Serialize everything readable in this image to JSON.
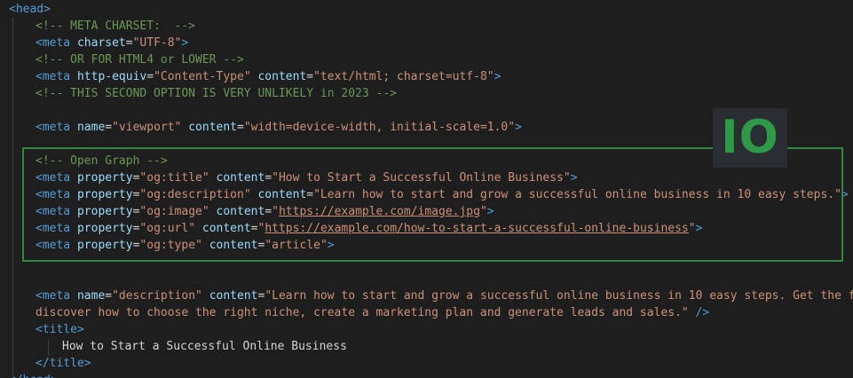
{
  "logo": {
    "text": "IO"
  },
  "lines": {
    "l0": {
      "open": "<",
      "tag": "head",
      "close": ">"
    },
    "l1": {
      "comment": "<!-- META CHARSET:  -->"
    },
    "l2": {
      "open": "<",
      "tag": "meta",
      "attr1": "charset",
      "eq1": "=",
      "val1": "\"UTF-8\"",
      "close": ">"
    },
    "l3": {
      "comment": "<!-- OR FOR HTML4 or LOWER -->"
    },
    "l4": {
      "open": "<",
      "tag": "meta",
      "attr1": "http-equiv",
      "eq1": "=",
      "val1": "\"Content-Type\"",
      "attr2": "content",
      "eq2": "=",
      "val2": "\"text/html; charset=utf-8\"",
      "close": ">"
    },
    "l5": {
      "comment": "<!-- THIS SECOND OPTION IS VERY UNLIKELY in 2023 -->"
    },
    "l7": {
      "open": "<",
      "tag": "meta",
      "attr1": "name",
      "eq1": "=",
      "val1": "\"viewport\"",
      "attr2": "content",
      "eq2": "=",
      "val2": "\"width=device-width, initial-scale=1.0\"",
      "close": ">"
    },
    "l9": {
      "comment": "<!-- Open Graph -->"
    },
    "l10": {
      "open": "<",
      "tag": "meta",
      "attr1": "property",
      "eq1": "=",
      "val1": "\"og:title\"",
      "attr2": "content",
      "eq2": "=",
      "val2": "\"How to Start a Successful Online Business\"",
      "close": ">"
    },
    "l11": {
      "open": "<",
      "tag": "meta",
      "attr1": "property",
      "eq1": "=",
      "val1": "\"og:description\"",
      "attr2": "content",
      "eq2": "=",
      "val2": "\"Learn how to start and grow a successful online business in 10 easy steps.\"",
      "close": ">"
    },
    "l12": {
      "open": "<",
      "tag": "meta",
      "attr1": "property",
      "eq1": "=",
      "val1": "\"og:image\"",
      "attr2": "content",
      "eq2": "=",
      "q_open": "\"",
      "url": "https://example.com/image.jpg",
      "q_close": "\"",
      "close": ">"
    },
    "l13": {
      "open": "<",
      "tag": "meta",
      "attr1": "property",
      "eq1": "=",
      "val1": "\"og:url\"",
      "attr2": "content",
      "eq2": "=",
      "q_open": "\"",
      "url": "https://example.com/how-to-start-a-successful-online-business",
      "q_close": "\"",
      "close": ">"
    },
    "l14": {
      "open": "<",
      "tag": "meta",
      "attr1": "property",
      "eq1": "=",
      "val1": "\"og:type\"",
      "attr2": "content",
      "eq2": "=",
      "val2": "\"article\"",
      "close": ">"
    },
    "l17": {
      "open": "<",
      "tag": "meta",
      "attr1": "name",
      "eq1": "=",
      "val1": "\"description\"",
      "attr2": "content",
      "eq2": "=",
      "val2": "\"Learn how to start and grow a successful online business in 10 easy steps. Get the fre"
    },
    "l18": {
      "val": "discover how to choose the right niche, create a marketing plan and generate leads and sales.\"",
      "close": " />"
    },
    "l19": {
      "open": "<",
      "tag": "title",
      "close": ">"
    },
    "l20": {
      "text": "How to Start a Successful Online Business"
    },
    "l21": {
      "open": "</",
      "tag": "title",
      "close": ">"
    },
    "l22": {
      "open": "</",
      "tag": "head",
      "close": ">"
    }
  }
}
